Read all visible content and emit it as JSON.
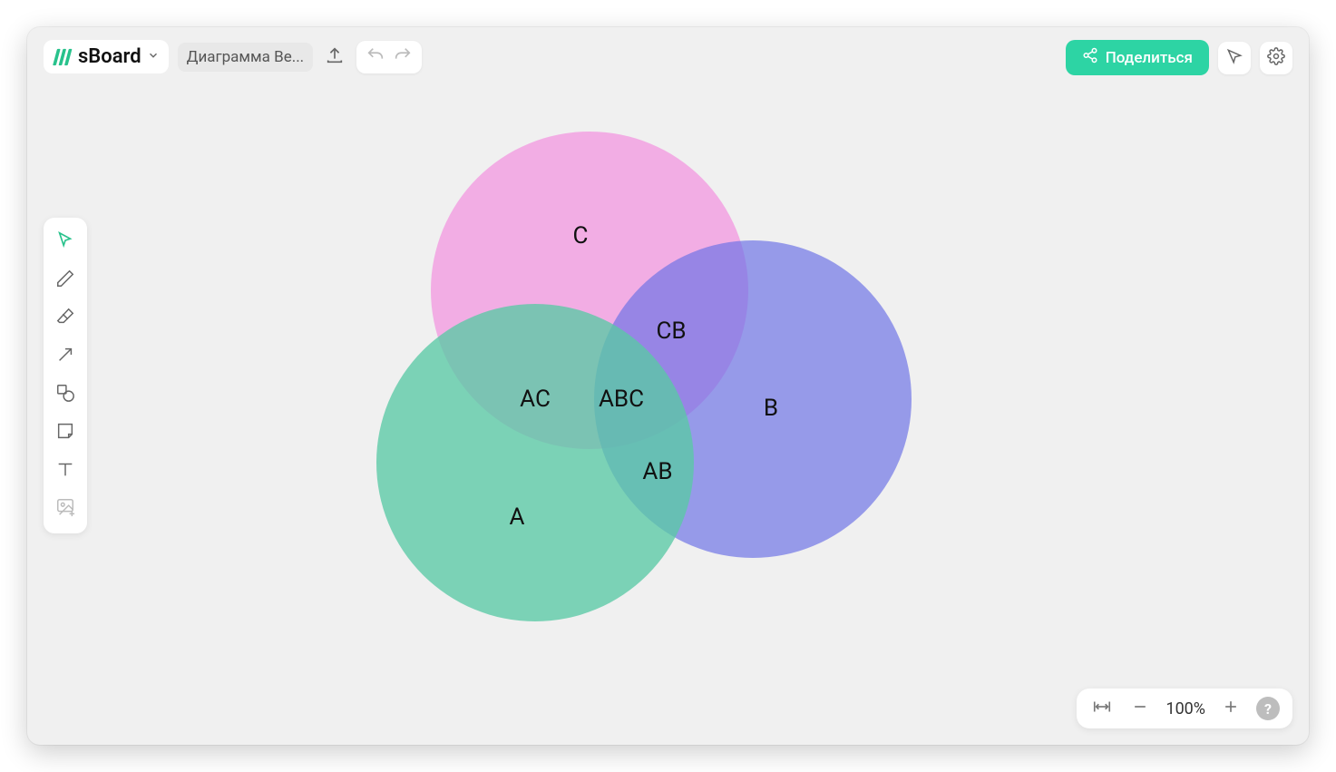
{
  "brand": {
    "name": "sBoard"
  },
  "document": {
    "title": "Диаграмма Ве..."
  },
  "share": {
    "label": "Поделиться"
  },
  "zoom": {
    "level": "100%"
  },
  "help": {
    "label": "?"
  },
  "toolbar": {
    "tools": [
      {
        "name": "select",
        "active": true
      },
      {
        "name": "pencil",
        "active": false
      },
      {
        "name": "eraser",
        "active": false
      },
      {
        "name": "arrow",
        "active": false
      },
      {
        "name": "shapes",
        "active": false
      },
      {
        "name": "sticky",
        "active": false
      },
      {
        "name": "text",
        "active": false
      },
      {
        "name": "image",
        "active": false
      }
    ]
  },
  "venn": {
    "labels": {
      "A": "A",
      "B": "B",
      "C": "C",
      "AB": "AB",
      "AC": "AC",
      "CB": "CB",
      "ABC": "ABC"
    },
    "colors": {
      "A": "#5ac9a5",
      "B": "#6b72e6",
      "C": "#f29ae0"
    }
  }
}
